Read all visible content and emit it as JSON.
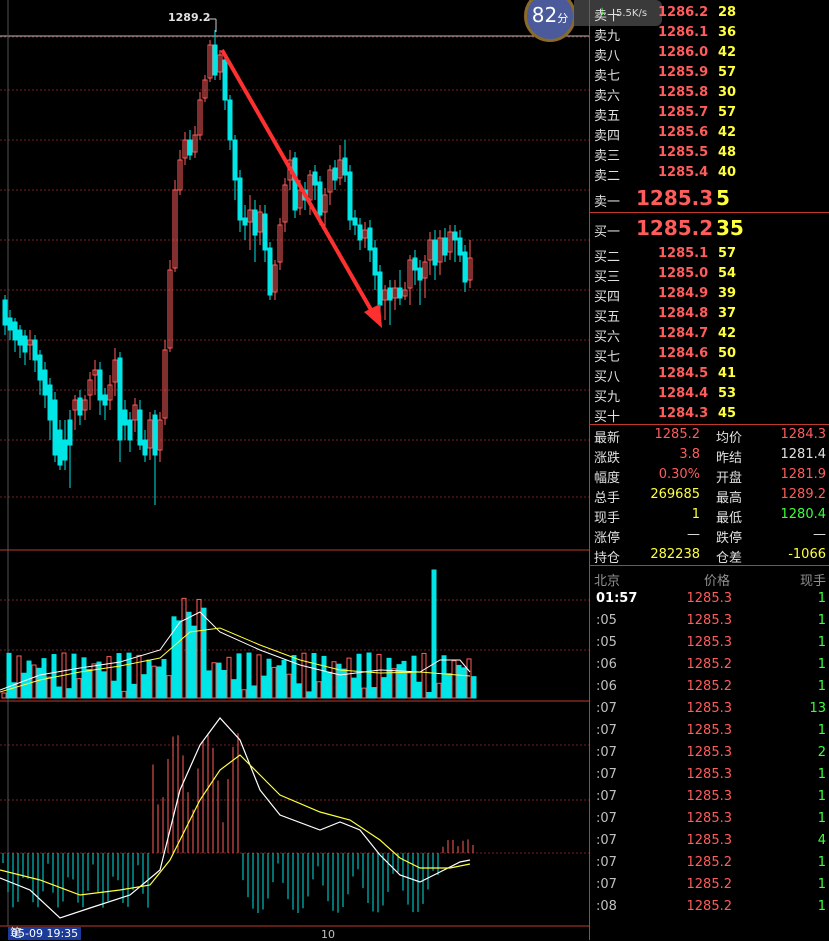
{
  "badge": {
    "score": "82",
    "score_unit": "分",
    "net_speed": "5.5K/s"
  },
  "chart": {
    "high_label": "1289.2",
    "date_label": "05-09 19:35",
    "axis_mid_label": "10"
  },
  "orderbook": {
    "asks": [
      {
        "label": "卖十",
        "price": "1286.2",
        "qty": "28"
      },
      {
        "label": "卖九",
        "price": "1286.1",
        "qty": "36"
      },
      {
        "label": "卖八",
        "price": "1286.0",
        "qty": "42"
      },
      {
        "label": "卖七",
        "price": "1285.9",
        "qty": "57"
      },
      {
        "label": "卖六",
        "price": "1285.8",
        "qty": "30"
      },
      {
        "label": "卖五",
        "price": "1285.7",
        "qty": "57"
      },
      {
        "label": "卖四",
        "price": "1285.6",
        "qty": "42"
      },
      {
        "label": "卖三",
        "price": "1285.5",
        "qty": "48"
      },
      {
        "label": "卖二",
        "price": "1285.4",
        "qty": "40"
      }
    ],
    "ask1": {
      "label": "卖一",
      "price": "1285.3",
      "qty": "5"
    },
    "bid1": {
      "label": "买一",
      "price": "1285.2",
      "qty": "35"
    },
    "bids": [
      {
        "label": "买二",
        "price": "1285.1",
        "qty": "57"
      },
      {
        "label": "买三",
        "price": "1285.0",
        "qty": "54"
      },
      {
        "label": "买四",
        "price": "1284.9",
        "qty": "39"
      },
      {
        "label": "买五",
        "price": "1284.8",
        "qty": "37"
      },
      {
        "label": "买六",
        "price": "1284.7",
        "qty": "42"
      },
      {
        "label": "买七",
        "price": "1284.6",
        "qty": "50"
      },
      {
        "label": "买八",
        "price": "1284.5",
        "qty": "41"
      },
      {
        "label": "买九",
        "price": "1284.4",
        "qty": "53"
      },
      {
        "label": "买十",
        "price": "1284.3",
        "qty": "45"
      }
    ]
  },
  "stats": [
    {
      "l1": "最新",
      "v1": "1285.2",
      "c1": "red",
      "l2": "均价",
      "v2": "1284.3",
      "c2": "red"
    },
    {
      "l1": "涨跌",
      "v1": "3.8",
      "c1": "red",
      "l2": "昨结",
      "v2": "1281.4",
      "c2": "wht"
    },
    {
      "l1": "幅度",
      "v1": "0.30%",
      "c1": "red",
      "l2": "开盘",
      "v2": "1281.9",
      "c2": "red"
    },
    {
      "l1": "总手",
      "v1": "269685",
      "c1": "yel",
      "l2": "最高",
      "v2": "1289.2",
      "c2": "red"
    },
    {
      "l1": "现手",
      "v1": "1",
      "c1": "yel",
      "l2": "最低",
      "v2": "1280.4",
      "c2": "grn"
    },
    {
      "l1": "涨停",
      "v1": "—",
      "c1": "wht",
      "l2": "跌停",
      "v2": "—",
      "c2": "wht"
    },
    {
      "l1": "持仓",
      "v1": "282238",
      "c1": "yel",
      "l2": "仓差",
      "v2": "-1066",
      "c2": "yel"
    }
  ],
  "ticks_header": {
    "time": "北京",
    "price": "价格",
    "vol": "现手"
  },
  "ticks": [
    {
      "time": "01:57",
      "price": "1285.3",
      "vol": "1"
    },
    {
      "time": ":05",
      "price": "1285.3",
      "vol": "1"
    },
    {
      "time": ":05",
      "price": "1285.3",
      "vol": "1"
    },
    {
      "time": ":06",
      "price": "1285.2",
      "vol": "1"
    },
    {
      "time": ":06",
      "price": "1285.2",
      "vol": "1"
    },
    {
      "time": ":07",
      "price": "1285.3",
      "vol": "13"
    },
    {
      "time": ":07",
      "price": "1285.3",
      "vol": "1"
    },
    {
      "time": ":07",
      "price": "1285.3",
      "vol": "2"
    },
    {
      "time": ":07",
      "price": "1285.3",
      "vol": "1"
    },
    {
      "time": ":07",
      "price": "1285.3",
      "vol": "1"
    },
    {
      "time": ":07",
      "price": "1285.3",
      "vol": "1"
    },
    {
      "time": ":07",
      "price": "1285.3",
      "vol": "4"
    },
    {
      "time": ":07",
      "price": "1285.2",
      "vol": "1"
    },
    {
      "time": ":07",
      "price": "1285.2",
      "vol": "1"
    },
    {
      "time": ":08",
      "price": "1285.2",
      "vol": "1"
    }
  ],
  "bottom_tab": "笔"
}
